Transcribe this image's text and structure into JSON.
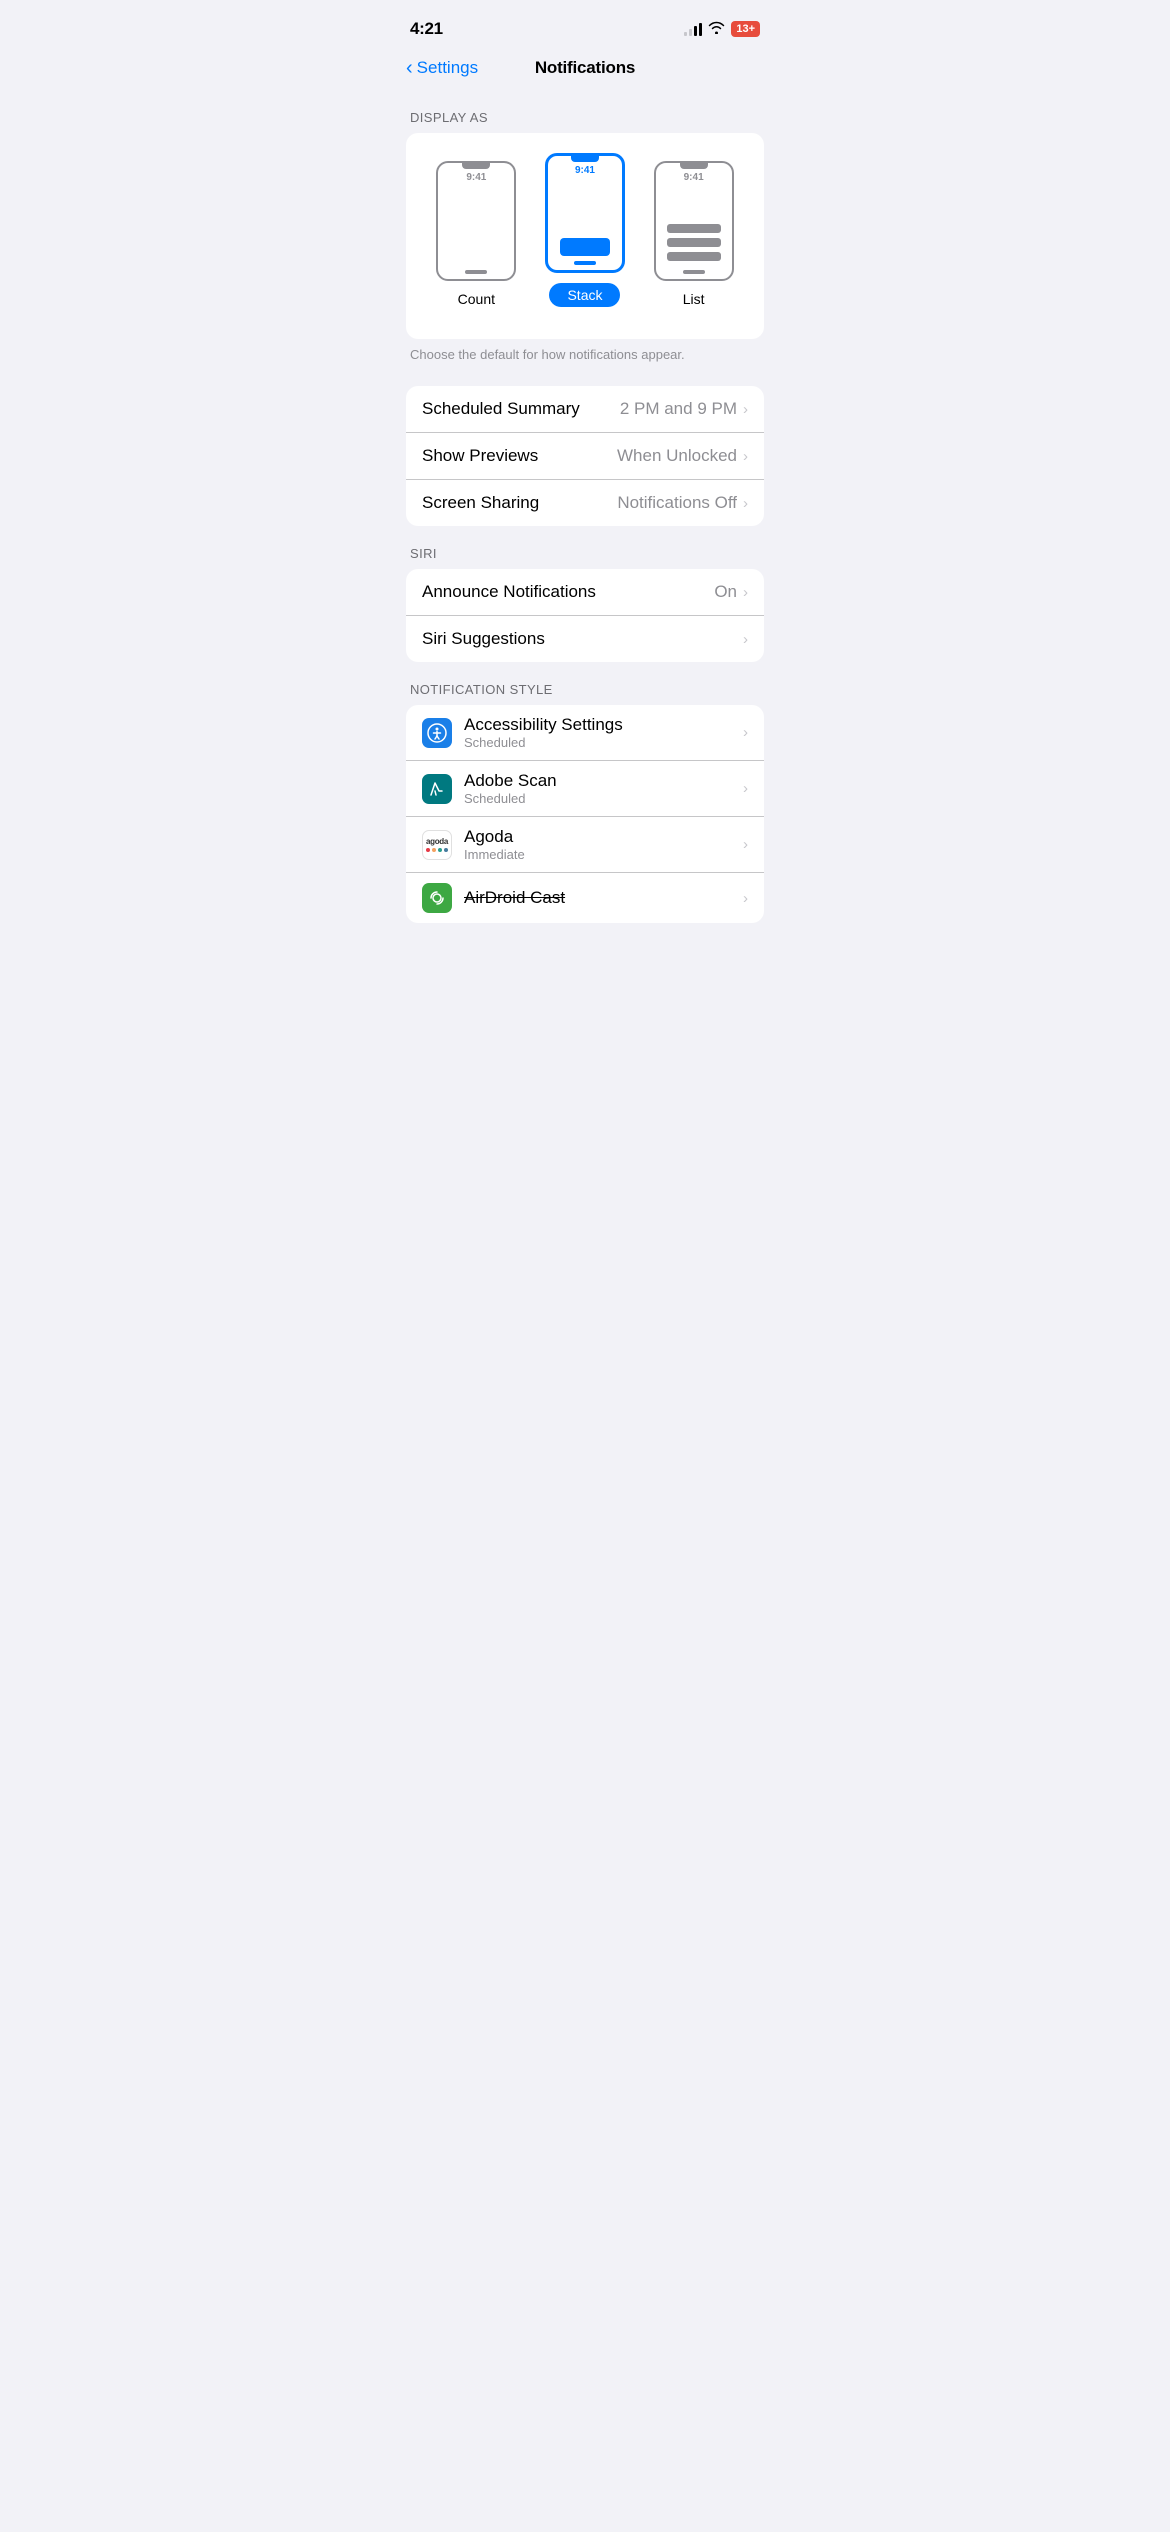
{
  "statusBar": {
    "time": "4:21",
    "battery": "13+"
  },
  "nav": {
    "back": "Settings",
    "title": "Notifications"
  },
  "displayAs": {
    "sectionLabel": "DISPLAY AS",
    "options": [
      {
        "id": "count",
        "label": "Count",
        "selected": false
      },
      {
        "id": "stack",
        "label": "Stack",
        "selected": true
      },
      {
        "id": "list",
        "label": "List",
        "selected": false
      }
    ],
    "hint": "Choose the default for how notifications appear.",
    "phoneTime": "9:41"
  },
  "generalRows": [
    {
      "title": "Scheduled Summary",
      "value": "2 PM and 9 PM"
    },
    {
      "title": "Show Previews",
      "value": "When Unlocked"
    },
    {
      "title": "Screen Sharing",
      "value": "Notifications Off"
    }
  ],
  "siriSection": {
    "label": "SIRI",
    "rows": [
      {
        "title": "Announce Notifications",
        "value": "On"
      },
      {
        "title": "Siri Suggestions",
        "value": ""
      }
    ]
  },
  "notificationStyleSection": {
    "label": "NOTIFICATION STYLE",
    "apps": [
      {
        "name": "Accessibility Settings",
        "subtitle": "Scheduled",
        "iconColor": "#1a7fe8",
        "iconBg": "#1a7fe8",
        "iconType": "accessibility"
      },
      {
        "name": "Adobe Scan",
        "subtitle": "Scheduled",
        "iconColor": "#cc1a1a",
        "iconBg": "#007980",
        "iconType": "adobe"
      },
      {
        "name": "Agoda",
        "subtitle": "Immediate",
        "iconColor": "#fff",
        "iconBg": "#fff",
        "iconType": "agoda"
      },
      {
        "name": "AirDroid Cast",
        "subtitle": "",
        "iconColor": "#4cd964",
        "iconBg": "#3da843",
        "iconType": "airdroid",
        "strikethrough": true
      }
    ]
  }
}
